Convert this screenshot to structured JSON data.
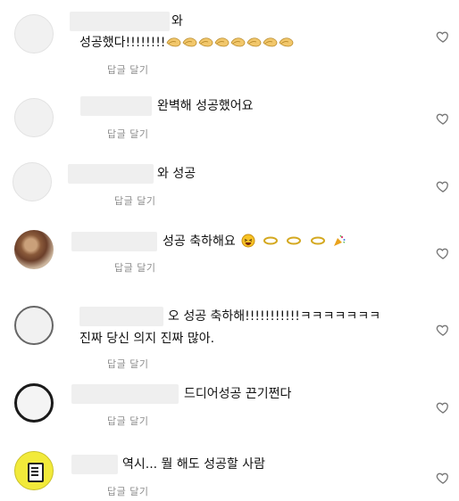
{
  "comments": [
    {
      "line1": "와",
      "line2": "성공했다!!!!!!!!",
      "reply": "답글 달기",
      "hand_count": 8
    },
    {
      "line1": "완벽해 성공했어요",
      "reply": "답글 달기"
    },
    {
      "line1": "와 성공",
      "reply": "답글 달기"
    },
    {
      "line1": "성공 축하해요",
      "reply": "답글 달기"
    },
    {
      "line1": "오 성공 축하해!!!!!!!!!!!ㅋㅋㅋㅋㅋㅋㅋ",
      "line2": "진짜 당신 의지 진짜 많아.",
      "reply": "답글 달기"
    },
    {
      "line1": "드디어성공 끈기쩐다",
      "reply": "답글 달기"
    },
    {
      "line1": "역시... 뭘 해도 성공할 사람",
      "reply": "답글 달기"
    }
  ],
  "icons": {
    "like": "heart-outline-icon",
    "clap": "clapping-hands-icon",
    "laugh": "laughing-face-icon",
    "ring": "ring-icon",
    "party": "party-popper-icon"
  }
}
